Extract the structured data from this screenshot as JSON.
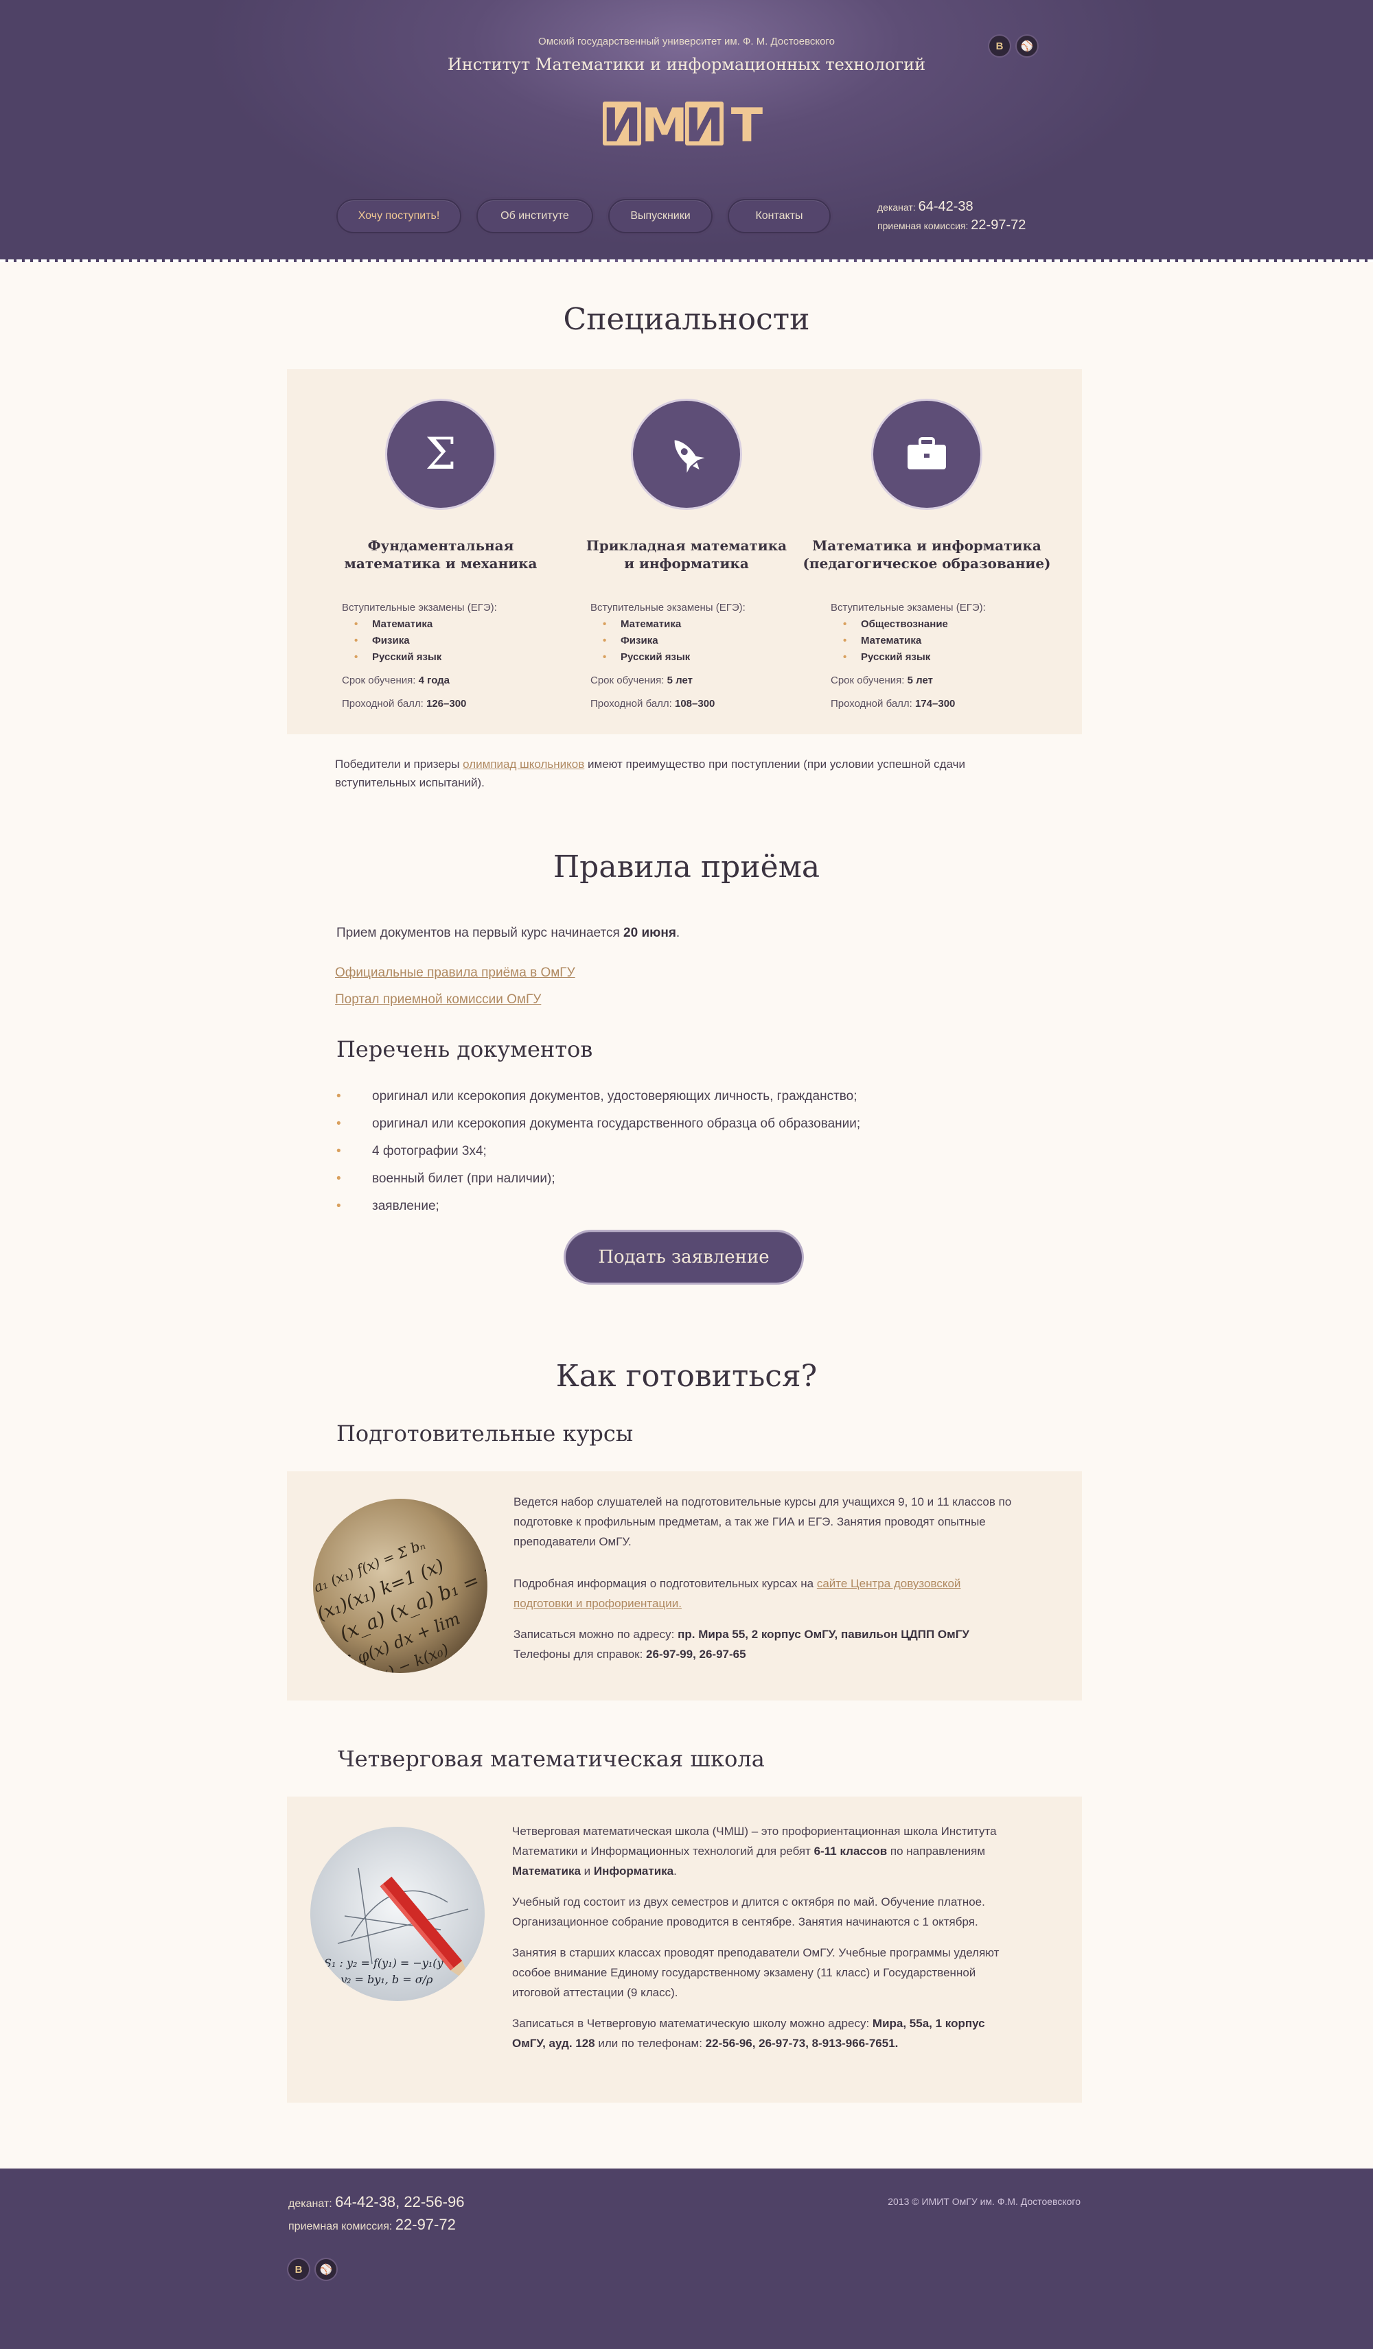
{
  "header": {
    "university": "Омский государственный университет им. Ф. М. Достоевского",
    "institute": "Институт Математики и информационных технологий",
    "logo": "ИМИТ",
    "social": [
      "В",
      "⚾"
    ],
    "nav": [
      "Хочу поступить!",
      "Об институте",
      "Выпускники",
      "Контакты"
    ],
    "phones": [
      {
        "label": "деканат:",
        "number": "64-42-38"
      },
      {
        "label": "приемная комиссия:",
        "number": "22-97-72"
      }
    ]
  },
  "specialties": {
    "title": "Специальности",
    "items": [
      {
        "icon": "Σ",
        "title_line1": "Фундаментальная",
        "title_line2": "математика и механика",
        "exams_label": "Вступительные экзамены (ЕГЭ):",
        "exams": [
          "Математика",
          "Физика",
          "Русский язык"
        ],
        "duration_label": "Срок обучения:",
        "duration": "4 года",
        "score_label": "Проходной балл:",
        "score": "126–300"
      },
      {
        "icon": "rocket",
        "title_line1": "Прикладная математика",
        "title_line2": "и информатика",
        "exams_label": "Вступительные экзамены (ЕГЭ):",
        "exams": [
          "Математика",
          "Физика",
          "Русский язык"
        ],
        "duration_label": "Срок обучения:",
        "duration": "5 лет",
        "score_label": "Проходной балл:",
        "score": "108–300"
      },
      {
        "icon": "briefcase",
        "title_line1": "Математика и информатика",
        "title_line2": "(педагогическое образование)",
        "exams_label": "Вступительные экзамены (ЕГЭ):",
        "exams": [
          "Обществознание",
          "Математика",
          "Русский язык"
        ],
        "duration_label": "Срок обучения:",
        "duration": "5 лет",
        "score_label": "Проходной балл:",
        "score": "174–300"
      }
    ],
    "note_before": "Победители и призеры ",
    "note_link": "олимпиад школьников",
    "note_after": " имеют преимущество при поступлении (при условии успешной сдачи",
    "note_line2": "вступительных испытаний)."
  },
  "rules": {
    "title": "Правила приёма",
    "start_text": "Прием документов на первый курс начинается ",
    "start_date": "20 июня",
    "links": [
      "Официальные правила приёма в ОмГУ",
      "Портал приемной комиссии ОмГУ"
    ],
    "docs_title": "Перечень документов",
    "docs": [
      "оригинал или ксерокопия документов, удостоверяющих личность, гражданство;",
      "оригинал или ксерокопия документа государственного образца об образовании;",
      "4 фотографии 3х4;",
      "военный билет (при наличии);",
      "заявление;"
    ],
    "apply_button": "Подать заявление"
  },
  "prepare": {
    "title": "Как готовиться?",
    "courses": {
      "title": "Подготовительные курсы",
      "p1": [
        "Ведется набор слушателей на подготовительные курсы для учащихся 9, 10 и 11 классов по",
        "подготовке к профильным предметам,  а так же ГИА и ЕГЭ.  Занятия проводят опытные",
        "преподаватели ОмГУ."
      ],
      "p2_text": "Подробная информация о подготовительных курсах на ",
      "p2_link1": "сайте Центра довузовской",
      "p2_link2": "подготовки и профориентации.",
      "addr_label": "Записаться можно по адресу: ",
      "addr": "пр. Мира 55, 2 корпус ОмГУ, павильон ЦДПП ОмГУ",
      "tel_label": "Телефоны для справок:  ",
      "tel": "26-97-99, 26-97-65"
    },
    "school": {
      "title": "Четверговая математическая школа",
      "p1_a": "Четверговая математическая школа (ЧМШ) – это профориентационная школа Института",
      "p1_b": "Математики и Информационных технологий для ребят ",
      "p1_bold": "6-11 классов",
      "p1_c": " по направлениям",
      "p1_d1": "Математика",
      "p1_and": " и ",
      "p1_d2": "Информатика",
      "p2": [
        "Учебный год состоит из двух семестров и длится  с октября по май. Обучение платное.",
        "Организационное собрание проводится в сентябре. Занятия начинаются с 1 октября."
      ],
      "p3": [
        "Занятия в старших классах проводят преподаватели ОмГУ. Учебные программы уделяют",
        "особое внимание Единому государственному экзамену (11 класс) и Государственной",
        "итоговой аттестации (9 класс)."
      ],
      "p4_a": "Записаться в Четверговую математическую школу можно адресу: ",
      "p4_addr1": "Мира, 55а, 1 корпус",
      "p4_addr2": "ОмГУ, ауд. 128",
      "p4_b": " или по телефонам: ",
      "p4_tel": "22-56-96, 26-97-73, 8-913-966-7651.",
      "formula1": "S₁ :  y₂ = f(y₁) = −y₁(y",
      "formula2": "y₂ = by₁,  b = σ/ρ"
    }
  },
  "footer": {
    "phones": [
      {
        "label": "деканат:",
        "number": "64-42-38, 22-56-96"
      },
      {
        "label": "приемная комиссия:",
        "number": "22-97-72"
      }
    ],
    "copyright": "2013 © ИМИТ ОмГУ им. Ф.М. Достоевского",
    "social": [
      "В",
      "⚾"
    ]
  },
  "colors": {
    "header_bg": "#5e4e76",
    "accent": "#d9a05e",
    "link": "#b08a62",
    "panel_bg": "#f8efe4",
    "page_bg": "#fdf9f4"
  }
}
